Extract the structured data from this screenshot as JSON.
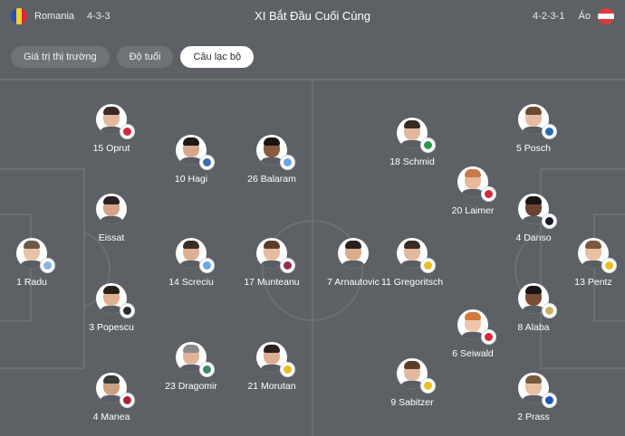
{
  "header": {
    "title": "XI Bắt Đầu Cuối Cùng",
    "home": {
      "name": "Romania",
      "formation": "4-3-3",
      "flag_colors": [
        "#2b4db0",
        "#f2d22e",
        "#d6283b"
      ]
    },
    "away": {
      "name": "Áo",
      "formation": "4-2-3-1",
      "flag_colors": [
        "#e03a3e",
        "#ffffff",
        "#e03a3e"
      ]
    }
  },
  "tabs": [
    {
      "label": "Giá trị thị trường",
      "active": false
    },
    {
      "label": "Độ tuổi",
      "active": false
    },
    {
      "label": "Câu lạc bộ",
      "active": true
    }
  ],
  "players": [
    {
      "label": "1 Radu",
      "club_icon": "celta-badge-icon",
      "club_color": "#8ab4e0",
      "skin": "#e8c3a8",
      "hair": "#6b5a4a"
    },
    {
      "label": "15 Oprut",
      "club_icon": "dinamo-badge-icon",
      "club_color": "#d6283b",
      "skin": "#e4b89c",
      "hair": "#3a2a22"
    },
    {
      "label": "Eissat",
      "club_icon": "",
      "club_color": "",
      "skin": "#d4a484",
      "hair": "#2a2020"
    },
    {
      "label": "3 Popescu",
      "club_icon": "gent-badge-icon",
      "club_color": "#2a2a2a",
      "skin": "#e2b090",
      "hair": "#2a1e18"
    },
    {
      "label": "4 Manea",
      "club_icon": "rapid-badge-icon",
      "club_color": "#b0203a",
      "skin": "#caa080",
      "hair": "#3a3a3a"
    },
    {
      "label": "10 Hagi",
      "club_icon": "alaves-badge-icon",
      "club_color": "#3b6fb0",
      "skin": "#d6a88a",
      "hair": "#1e1a18"
    },
    {
      "label": "14 Screciu",
      "club_icon": "craiova-badge-icon",
      "club_color": "#6aa8e0",
      "skin": "#dcb090",
      "hair": "#3a2e26"
    },
    {
      "label": "23 Dragomir",
      "club_icon": "pafos-badge-icon",
      "club_color": "#3a8a6a",
      "skin": "#e0b498",
      "hair": "#8a8a8a"
    },
    {
      "label": "26 Balaram",
      "club_icon": "craiova-badge-icon",
      "club_color": "#6aa8e0",
      "skin": "#8a5a3e",
      "hair": "#1a1414"
    },
    {
      "label": "17 Munteanu",
      "club_icon": "cfr-badge-icon",
      "club_color": "#9a2a4a",
      "skin": "#e6bca0",
      "hair": "#5a3e2a"
    },
    {
      "label": "21 Morutan",
      "club_icon": "aris-badge-icon",
      "club_color": "#e8c020",
      "skin": "#dcae90",
      "hair": "#2a2020"
    },
    {
      "label": "5 Posch",
      "club_icon": "como-badge-icon",
      "club_color": "#2a6ab0",
      "skin": "#e6bca0",
      "hair": "#6a4a30"
    },
    {
      "label": "4 Danso",
      "club_icon": "spurs-badge-icon",
      "club_color": "#1a1a2a",
      "skin": "#6a4430",
      "hair": "#1a1414"
    },
    {
      "label": "8 Alaba",
      "club_icon": "real-madrid-badge-icon",
      "club_color": "#c8b060",
      "skin": "#7a4e36",
      "hair": "#1a1414"
    },
    {
      "label": "2 Prass",
      "club_icon": "hoffenheim-badge-icon",
      "club_color": "#1a5ab0",
      "skin": "#e8c0a4",
      "hair": "#7a5a3e"
    },
    {
      "label": "18 Schmid",
      "club_icon": "bremen-badge-icon",
      "club_color": "#2a9a4a",
      "skin": "#e4b89c",
      "hair": "#3a2a22"
    },
    {
      "label": "20 Laimer",
      "club_icon": "bayern-badge-icon",
      "club_color": "#d6283b",
      "skin": "#e8b898",
      "hair": "#c87a4a"
    },
    {
      "label": "6 Seiwald",
      "club_icon": "leipzig-badge-icon",
      "club_color": "#d6283b",
      "skin": "#f0c4a8",
      "hair": "#d07a3e"
    },
    {
      "label": "7 Arnautovic",
      "club_icon": "",
      "club_color": "",
      "skin": "#d8ac8c",
      "hair": "#2a2020"
    },
    {
      "label": "11 Gregoritsch",
      "club_icon": "brondby-badge-icon",
      "club_color": "#e8c020",
      "skin": "#e4b89c",
      "hair": "#3a2a22"
    },
    {
      "label": "9 Sabitzer",
      "club_icon": "dortmund-badge-icon",
      "club_color": "#e8c020",
      "skin": "#e4b89c",
      "hair": "#5a3e2a"
    },
    {
      "label": "13 Pentz",
      "club_icon": "brondby-badge-icon",
      "club_color": "#e8c020",
      "skin": "#e8c0a4",
      "hair": "#7a5a3e"
    }
  ]
}
